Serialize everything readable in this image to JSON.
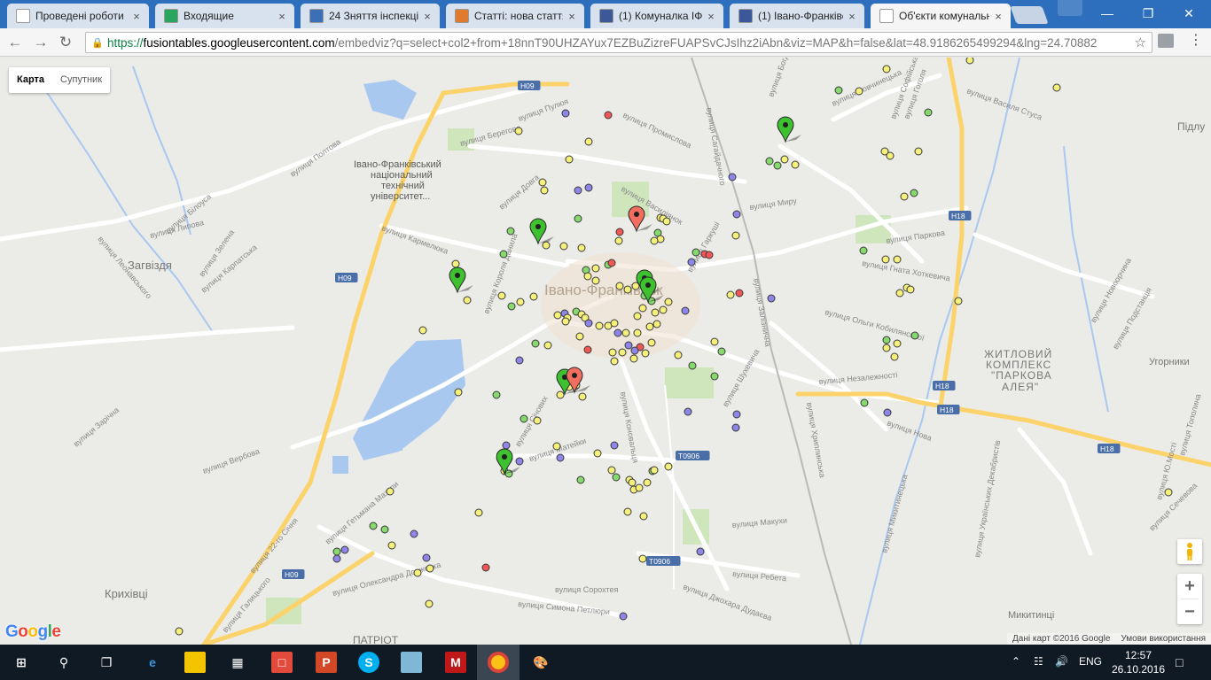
{
  "browser": {
    "tabs": [
      {
        "title": "Проведені роботи",
        "favicon": "page-icon",
        "color": "#ffffff"
      },
      {
        "title": "Входящие",
        "favicon": "mail-icon",
        "color": "#2aa55e"
      },
      {
        "title": "24 Зняття інспекцією",
        "favicon": "news24-icon",
        "color": "#3b6fb6"
      },
      {
        "title": "Статті: нова стаття",
        "favicon": "cms-icon",
        "color": "#e07b2e"
      },
      {
        "title": "(1) Комуналка ІФ",
        "favicon": "facebook-icon",
        "color": "#3b5998"
      },
      {
        "title": "(1) Івано-Франківс",
        "favicon": "facebook-icon",
        "color": "#3b5998"
      },
      {
        "title": "Об'єкти комунальн",
        "favicon": "page-icon",
        "color": "#ffffff"
      }
    ],
    "url": {
      "scheme": "https://",
      "host": "fusiontables.googleusercontent.com",
      "rest": "/embedviz?q=select+col2+from+18nnT90UHZAYux7EZBuZizreFUAPSvCJsIhz2iAbn&viz=MAP&h=false&lat=48.9186265499294&lng=24.70882"
    }
  },
  "map": {
    "type_buttons": [
      "Карта",
      "Супутник"
    ],
    "zoom_in": "+",
    "zoom_out": "−",
    "google_logo": "Google",
    "attribution": "Дані карт ©2016 Google",
    "terms": "Умови використання",
    "city_label": "Івано-Франківськ",
    "labels": [
      {
        "t": "Загвіздя",
        "c": "district"
      },
      {
        "t": "Крихівці",
        "c": "district"
      },
      {
        "t": "Угорники",
        "c": "district"
      },
      {
        "t": "Микитинці",
        "c": "district"
      },
      {
        "t": "Підлу",
        "c": "district"
      },
      {
        "t": "ПАТРІОТ",
        "c": "district"
      },
      {
        "t": "ЖИТЛОВИЙ",
        "c": "poi"
      },
      {
        "t": "КОМПЛЕКС",
        "c": "poi"
      },
      {
        "t": "\"ПАРКОВА",
        "c": "poi"
      },
      {
        "t": "АЛЕЯ\"",
        "c": "poi"
      },
      {
        "t": "Івано-Франківський",
        "c": "poi2"
      },
      {
        "t": "національний",
        "c": "poi2"
      },
      {
        "t": "технічний",
        "c": "poi2"
      },
      {
        "t": "університет...",
        "c": "poi2"
      }
    ],
    "street_labels": [
      "вулиця Липова",
      "вулиця Полтова",
      "вулиця Берегова",
      "вулиця Пулюя",
      "вулиця Промислова",
      "вулиця Василіянок",
      "вулиця Миру",
      "вулиця Гаркуші",
      "вулиця Паркова",
      "вулиця Гната Хоткевича",
      "вулиця Ольги Кобилянської",
      "вулиця Незалежності",
      "вулиця Коновальця",
      "вулиця Матейки",
      "вулиця Макухи",
      "вулиця Ребета",
      "вулиця Сорохтея",
      "вулиця Симона Петлюри",
      "вулиця Джохара Дудаєва",
      "вулиця Олександра Довженка",
      "вулиця Гетьмана Мазепи",
      "вулиця 22-го Січня",
      "вулиця Вербова",
      "вулиця Зарічна",
      "вулиця Леонавського",
      "вулиця Зелена",
      "вулиця Білоуса",
      "вулиця Карпатська",
      "вулиця Сечевова",
      "вулиця Микитинецька",
      "вулиця Хриплинська",
      "вулиця Залізнична",
      "вулиця Тополина",
      "вулиця Ю.Мості",
      "вулиця Шухевича",
      "вулиця Нова",
      "вулиця Довга",
      "вулиця Січових",
      "вулиця Галицького",
      "вулиця Вовчинецька",
      "вулиця Василя Стуса",
      "вулиця Богдана",
      "вулиця Гоголя",
      "вулиця Софійська",
      "вулиця Короля Данила",
      "вулиця Кармелюка",
      "вулиця Сагайдачного",
      "вулиця Новоорчина",
      "вулиця Подстанція",
      "вулиця Українських Декабристів"
    ],
    "road_badges": [
      "H09",
      "H09",
      "H09",
      "H18",
      "H18",
      "H18",
      "H18",
      "T0906",
      "T0906"
    ],
    "marker_colors": {
      "green": "#3ec12f",
      "red": "#f26e60",
      "yellow": "#f5f07a",
      "lgreen": "#86d96d",
      "blue": "#8d86e8",
      "pred": "#f25757"
    }
  },
  "taskbar": {
    "lang": "ENG",
    "time": "12:57",
    "date": "26.10.2016"
  }
}
